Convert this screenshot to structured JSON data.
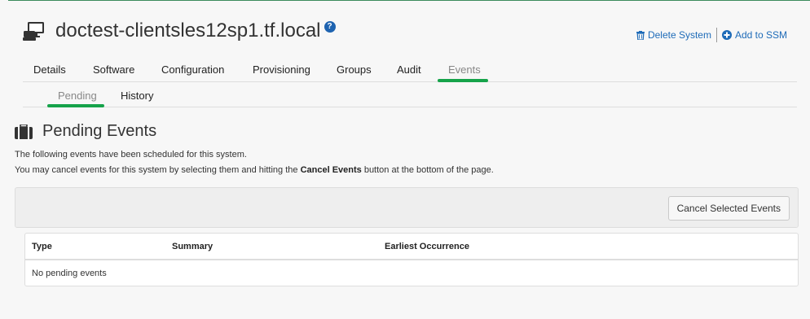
{
  "header": {
    "system_name": "doctest-clientsles12sp1.tf.local",
    "help_icon": "question-circle-icon",
    "actions": {
      "delete_label": "Delete System",
      "delete_icon": "trash-icon",
      "add_label": "Add to SSM",
      "add_icon": "plus-circle-icon"
    }
  },
  "tabs": [
    {
      "label": "Details"
    },
    {
      "label": "Software"
    },
    {
      "label": "Configuration"
    },
    {
      "label": "Provisioning"
    },
    {
      "label": "Groups"
    },
    {
      "label": "Audit"
    },
    {
      "label": "Events",
      "active": true
    }
  ],
  "subtabs": [
    {
      "label": "Pending",
      "active": true
    },
    {
      "label": "History"
    }
  ],
  "section": {
    "title": "Pending Events",
    "icon": "briefcase-icon",
    "desc_line1": "The following events have been scheduled for this system.",
    "desc_line2_before": "You may cancel events for this system by selecting them and hitting the ",
    "desc_line2_bold": "Cancel Events",
    "desc_line2_after": " button at the bottom of the page."
  },
  "toolbar": {
    "cancel_button": "Cancel Selected Events"
  },
  "table": {
    "columns": [
      "Type",
      "Summary",
      "Earliest Occurrence"
    ],
    "empty_message": "No pending events"
  },
  "colors": {
    "accent_green": "#16a34a",
    "link_blue": "#1e6bb8"
  }
}
